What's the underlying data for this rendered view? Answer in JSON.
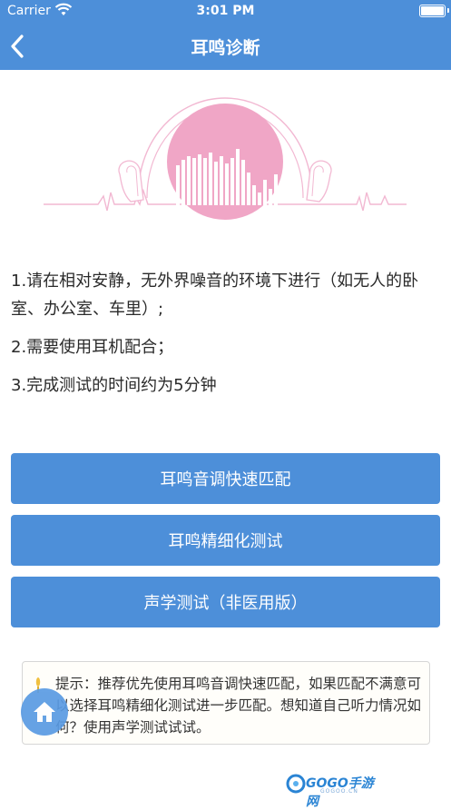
{
  "status_bar": {
    "carrier": "Carrier",
    "time": "3:01 PM"
  },
  "nav": {
    "title": "耳鸣诊断"
  },
  "instructions": [
    "1.请在相对安静，无外界噪音的环境下进行（如无人的卧室、办公室、车里）;",
    "2.需要使用耳机配合；",
    "3.完成测试的时间约为5分钟"
  ],
  "buttons": {
    "quick_match": "耳鸣音调快速匹配",
    "fine_test": "耳鸣精细化测试",
    "acoustic_test": "声学测试（非医用版）"
  },
  "tip": {
    "text": "提示：推荐优先使用耳鸣音调快速匹配，如果匹配不满意可以选择耳鸣精细化测试进一步匹配。想知道自己听力情况如何？使用声学测试试试。"
  },
  "watermark": {
    "brand": "GOGO手游网",
    "domain": "GOGOO.CN"
  },
  "colors": {
    "primary": "#4d8fd9",
    "accent_pink": "#f0a6c6",
    "line_pink": "#f2b8d2"
  }
}
